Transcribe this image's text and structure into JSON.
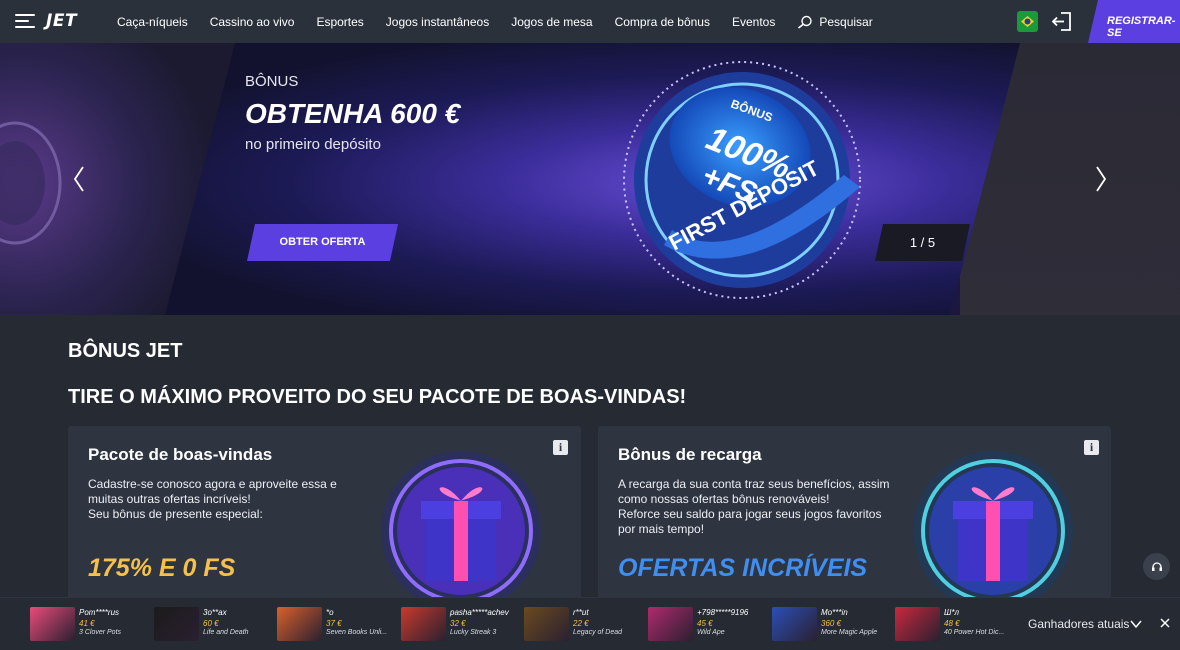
{
  "header": {
    "logo": "JET",
    "nav": [
      "Caça-níqueis",
      "Cassino ao vivo",
      "Esportes",
      "Jogos instantâneos",
      "Jogos de mesa",
      "Compra de bônus",
      "Eventos"
    ],
    "search_label": "Pesquisar",
    "register_label": "REGISTRAR-SE",
    "colors": {
      "accent": "#5b3fe0",
      "flag_green": "#1a9b3b"
    }
  },
  "hero": {
    "kicker": "BÔNUS",
    "headline": "OBTENHA 600 €",
    "subline": "no primeiro depósito",
    "cta_label": "OBTER OFERTA",
    "counter": "1 / 5",
    "medal": {
      "top": "BÔNUS",
      "main": "100%",
      "fs": "+FS",
      "ring": "FIRST DEPOSIT"
    }
  },
  "section": {
    "title": "BÔNUS JET",
    "subtitle": "TIRE O MÁXIMO PROVEITO DO SEU PACOTE DE BOAS-VINDAS!"
  },
  "cards": [
    {
      "title": "Pacote de boas-vindas",
      "lines": [
        "Cadastre-se conosco agora e aproveite essa e muitas outras ofertas incríveis!",
        "Seu bônus de presente especial:"
      ],
      "highlight": "175% E 0 FS",
      "highlight_color": "#f5c04b"
    },
    {
      "title": "Bônus de recarga",
      "lines": [
        "A recarga da sua conta traz seus benefícios, assim como nossas ofertas bônus renováveis!",
        "Reforce seu saldo para jogar seus jogos favoritos por mais tempo!"
      ],
      "highlight": "OFERTAS INCRÍVEIS",
      "highlight_color": "#3f8ef0"
    }
  ],
  "winners": {
    "label": "Ganhadores atuais",
    "items": [
      {
        "user": "Pom****rus",
        "amount": "41 €",
        "game": "3 Clover Pots",
        "color": "#e94b7a"
      },
      {
        "user": "3o**ax",
        "amount": "60 €",
        "game": "Life and Death",
        "color": "#1b1b1b"
      },
      {
        "user": "*o",
        "amount": "37 €",
        "game": "Seven Books Unli...",
        "color": "#d9612a"
      },
      {
        "user": "pasha*****achev",
        "amount": "32 €",
        "game": "Lucky Streak 3",
        "color": "#c93a2c"
      },
      {
        "user": "r**ut",
        "amount": "22 €",
        "game": "Legacy of Dead",
        "color": "#6b4a1e"
      },
      {
        "user": "+798*****9196",
        "amount": "45 €",
        "game": "Wild Ape",
        "color": "#b02a6d"
      },
      {
        "user": "Mo***in",
        "amount": "360 €",
        "game": "More Magic Apple",
        "color": "#2b4fb8"
      },
      {
        "user": "Ш*л",
        "amount": "48 €",
        "game": "40 Power Hot Dic...",
        "color": "#c9283d"
      }
    ]
  }
}
